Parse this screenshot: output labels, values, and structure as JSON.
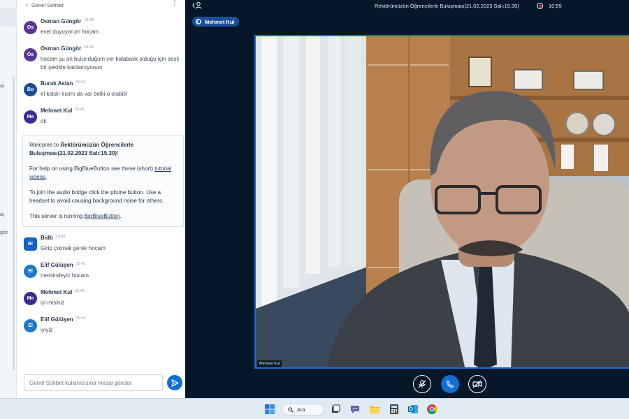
{
  "chat": {
    "title": "Genel Sohbet",
    "input_placeholder": "Genel Sohbet kullanıcısına mesaj gönder",
    "messages": [
      {
        "initials": "Os",
        "name": "Osman Güngör",
        "time": "15:40",
        "text": "evet duyuyorum hocam",
        "color": "#5b3596"
      },
      {
        "initials": "Os",
        "name": "Osman Güngör",
        "time": "15:41",
        "text": "hocam şu an bulunduğum yer kalabalık olduğu için sesli bir şekilde katılamıyorum",
        "color": "#5b3596"
      },
      {
        "initials": "Bu",
        "name": "Burak Aslan",
        "time": "15:41",
        "text": "el kaldır kısmı da var belki o olabilir",
        "color": "#1d4b9b"
      },
      {
        "initials": "Me",
        "name": "Mehmet Kul",
        "time": "15:41",
        "text": "ok",
        "color": "#3b2b8e"
      },
      {
        "initials": "Bi",
        "name": "Bidb",
        "time": "15:42",
        "text": "Girip çıkmak gerek hocam",
        "color": "#1462c4"
      },
      {
        "initials": "El",
        "name": "Elif Gülüşen",
        "time": "15:42",
        "text": "mersindeyiz hocam",
        "color": "#1f78c8"
      },
      {
        "initials": "Me",
        "name": "Mehmet Kul",
        "time": "15:43",
        "text": "iyi misiniz",
        "color": "#3b2b8e"
      },
      {
        "initials": "El",
        "name": "Elif Gülüşen",
        "time": "15:44",
        "text": "iyiyiz",
        "color": "#1f78c8"
      }
    ],
    "welcome": {
      "prefix": "Welcome to ",
      "meeting_bold": "Rektörümüzün Öğrencilerle Buluşması(21.02.2023 Salı:15.30)",
      "suffix": "!",
      "help_text": "For help on using BigBlueButton see these (short) ",
      "help_link": "tutorial videos",
      "help_end": ".",
      "audio_text": "To join the audio bridge click the phone button. Use a headset to avoid causing background noise for others.",
      "server_text": "This server is running ",
      "server_link": "BigBlueButton",
      "server_end": "."
    }
  },
  "userlist_fragments": [
    "aj",
    "aj",
    "göz"
  ],
  "meeting": {
    "title": "Rektörümüzün Öğrencilerle Buluşması(21.02.2023 Salı:15.30)",
    "recording_time": "10:55",
    "talker": "Mehmet Kul",
    "video_label": "Mehmet Kul"
  },
  "taskbar": {
    "search_label": "Ara"
  }
}
